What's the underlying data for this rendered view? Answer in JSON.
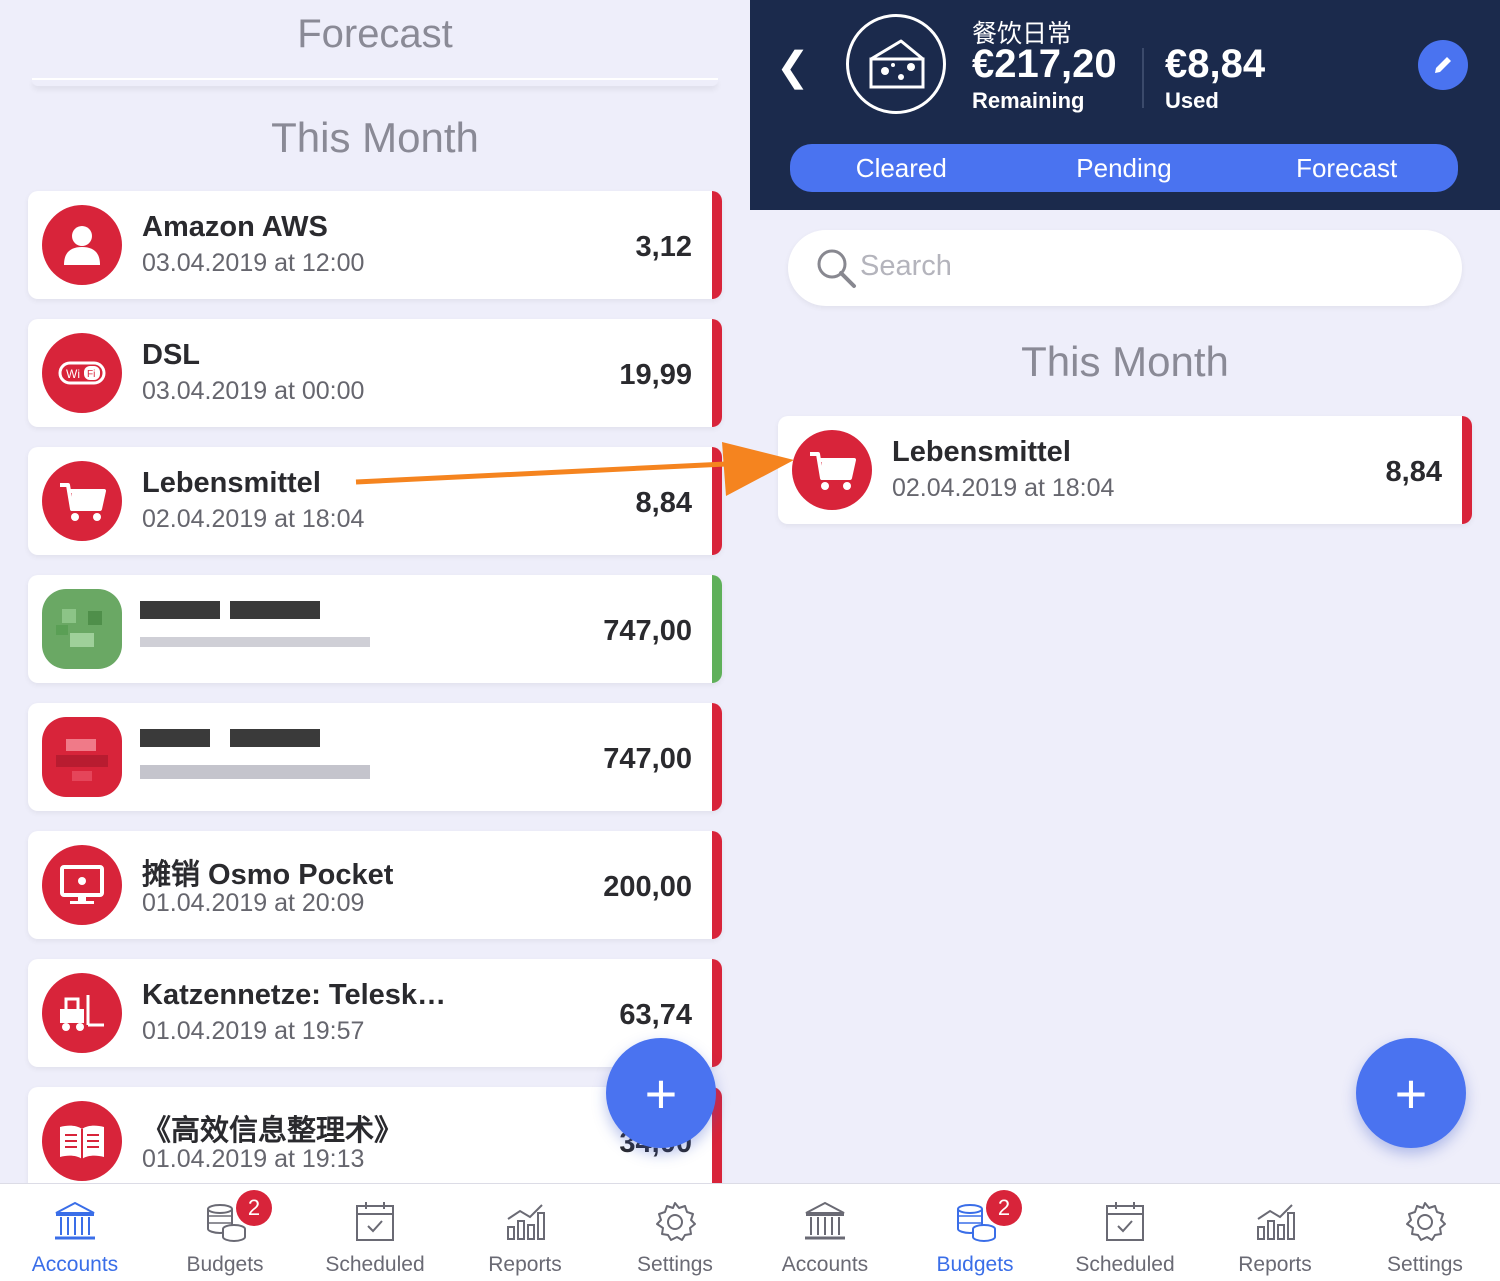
{
  "left": {
    "forecast_header": "Forecast",
    "section_title": "This Month",
    "transactions": [
      {
        "title": "Amazon AWS",
        "date": "03.04.2019 at 12:00",
        "amount": "3,12",
        "icon": "person-icon",
        "status_color": "#d8243a"
      },
      {
        "title": "DSL",
        "date": "03.04.2019 at 00:00",
        "amount": "19,99",
        "icon": "wifi-icon",
        "status_color": "#d8243a"
      },
      {
        "title": "Lebensmittel",
        "date": "02.04.2019 at 18:04",
        "amount": "8,84",
        "icon": "shopping-cart-icon",
        "status_color": "#d8243a"
      },
      {
        "title": "",
        "date": "",
        "amount": "747,00",
        "icon": "pixelated-icon",
        "status_color": "#5fb05a"
      },
      {
        "title": "",
        "date": "",
        "amount": "747,00",
        "icon": "pixelated-icon",
        "status_color": "#d8243a"
      },
      {
        "title": "摊销 Osmo Pocket",
        "date": "01.04.2019 at 20:09",
        "amount": "200,00",
        "icon": "computer-icon",
        "status_color": "#d8243a"
      },
      {
        "title": "Katzennetze: Telesk…",
        "date": "01.04.2019 at 19:57",
        "amount": "63,74",
        "icon": "forklift-icon",
        "status_color": "#d8243a"
      },
      {
        "title": "《高效信息整理术》",
        "date": "01.04.2019 at 19:13",
        "amount": "34,00",
        "icon": "book-icon",
        "status_color": "#d8243a"
      }
    ]
  },
  "right": {
    "budget_name": "餐饮日常",
    "remaining_amount": "€217,20",
    "remaining_label": "Remaining",
    "used_amount": "€8,84",
    "used_label": "Used",
    "segments": [
      "Cleared",
      "Pending",
      "Forecast"
    ],
    "search_placeholder": "Search",
    "section_title": "This Month",
    "transaction": {
      "title": "Lebensmittel",
      "date": "02.04.2019 at 18:04",
      "amount": "8,84"
    }
  },
  "fab_label": "+",
  "tabbar": {
    "items": [
      "Accounts",
      "Budgets",
      "Scheduled",
      "Reports",
      "Settings"
    ],
    "badge": "2"
  },
  "colors": {
    "accent": "#4a73f0",
    "header": "#1b2a4c",
    "expense": "#d8243a",
    "income": "#5fb05a",
    "annotation_arrow": "#f5841f"
  }
}
